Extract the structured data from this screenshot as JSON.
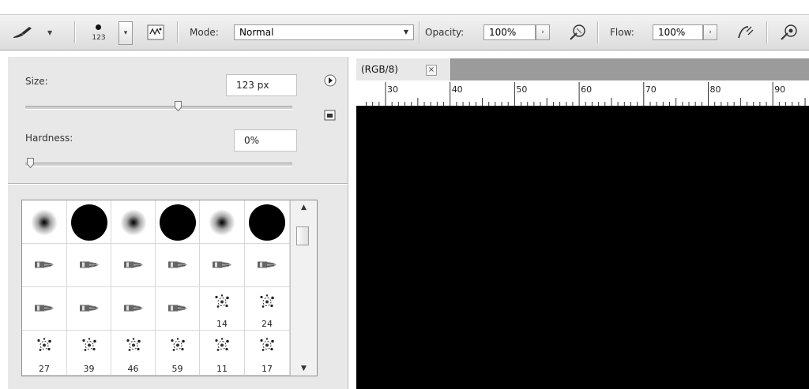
{
  "toolbar": {
    "brush_size_preview": "123",
    "mode_label": "Mode:",
    "mode_value": "Normal",
    "opacity_label": "Opacity:",
    "opacity_value": "100%",
    "flow_label": "Flow:",
    "flow_value": "100%"
  },
  "brush_panel": {
    "size_label": "Size:",
    "size_value": "123 px",
    "size_fraction": 0.57,
    "hardness_label": "Hardness:",
    "hardness_value": "0%",
    "hardness_fraction": 0.0
  },
  "brush_presets": {
    "rows": [
      [
        {
          "kind": "soft",
          "size": ""
        },
        {
          "kind": "hard",
          "size": ""
        },
        {
          "kind": "soft",
          "size": ""
        },
        {
          "kind": "hard",
          "size": ""
        },
        {
          "kind": "soft",
          "size": ""
        },
        {
          "kind": "hard",
          "size": ""
        }
      ],
      [
        {
          "kind": "tip",
          "size": ""
        },
        {
          "kind": "tip",
          "size": ""
        },
        {
          "kind": "tip",
          "size": ""
        },
        {
          "kind": "tip",
          "size": ""
        },
        {
          "kind": "tip",
          "size": ""
        },
        {
          "kind": "tip",
          "size": ""
        }
      ],
      [
        {
          "kind": "tip",
          "size": ""
        },
        {
          "kind": "tip",
          "size": ""
        },
        {
          "kind": "tip",
          "size": ""
        },
        {
          "kind": "tip",
          "size": ""
        },
        {
          "kind": "scatter",
          "size": "14"
        },
        {
          "kind": "scatter",
          "size": "24"
        }
      ],
      [
        {
          "kind": "scatter",
          "size": "27"
        },
        {
          "kind": "scatter",
          "size": "39"
        },
        {
          "kind": "scatter",
          "size": "46"
        },
        {
          "kind": "scatter",
          "size": "59"
        },
        {
          "kind": "scatter",
          "size": "11"
        },
        {
          "kind": "scatter",
          "size": "17"
        }
      ]
    ]
  },
  "document": {
    "tab_title": "(RGB/8)",
    "close_glyph": "×",
    "ruler_labels": [
      "30",
      "40",
      "50",
      "60",
      "70",
      "80",
      "90"
    ]
  }
}
